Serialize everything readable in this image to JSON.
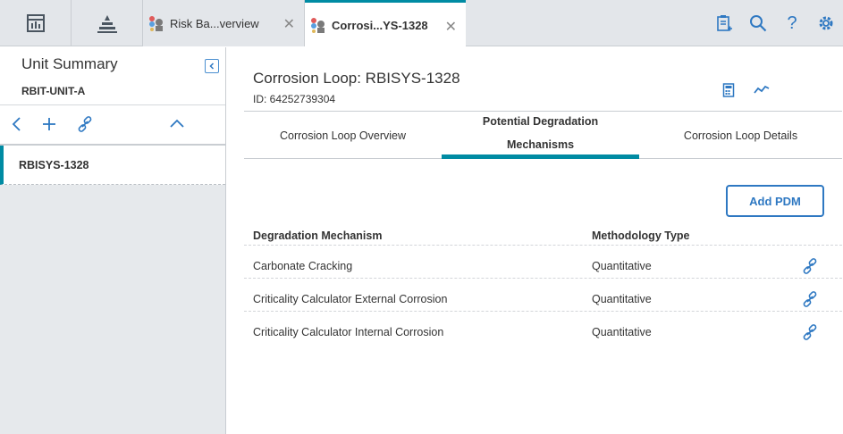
{
  "topbar": {
    "tabs": [
      {
        "label": "Risk Ba...verview",
        "active": false
      },
      {
        "label": "Corrosi...YS-1328",
        "active": true
      }
    ],
    "icons": [
      "dashboard-icon",
      "hierarchy-icon",
      "clipboard-icon",
      "search-icon",
      "help-icon",
      "gear-icon"
    ],
    "help_glyph": "?"
  },
  "sidebar": {
    "title": "Unit Summary",
    "subtitle": "RBIT-UNIT-A",
    "items": [
      {
        "label": "RBISYS-1328"
      }
    ]
  },
  "main": {
    "title": "Corrosion Loop: RBISYS-1328",
    "id_text": "ID: 64252739304",
    "tabs": [
      {
        "label": "Corrosion Loop Overview",
        "active": false
      },
      {
        "label": "Potential Degradation Mechanisms",
        "active": true
      },
      {
        "label": "Corrosion Loop Details",
        "active": false
      }
    ],
    "add_button": "Add PDM",
    "table": {
      "headers": [
        "Degradation Mechanism",
        "Methodology Type"
      ],
      "rows": [
        {
          "mechanism": "Carbonate Cracking",
          "type": "Quantitative"
        },
        {
          "mechanism": "Criticality Calculator External Corrosion",
          "type": "Quantitative"
        },
        {
          "mechanism": "Criticality Calculator Internal Corrosion",
          "type": "Quantitative"
        }
      ]
    }
  },
  "colors": {
    "accent": "#008ba3",
    "link": "#2e78c2",
    "topbar_bg": "#e3e6ea"
  }
}
